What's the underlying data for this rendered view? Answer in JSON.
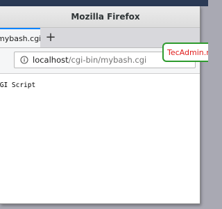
{
  "window": {
    "title": "Mozilla Firefox"
  },
  "tabs": [
    {
      "label": "mybash.cgi",
      "active": true
    }
  ],
  "new_tab_glyph": "+",
  "urlbar": {
    "host": "localhost",
    "path": "/cgi-bin/mybash.cgi",
    "icon": "info-icon"
  },
  "page": {
    "text": "CGI Script"
  },
  "watermark": {
    "text": "TecAdmin.net",
    "border_color": "#2e9b2e",
    "text_color": "#e01b1b"
  },
  "colors": {
    "tab_accent": "#0a84ff",
    "desktop": "#a9a9b3"
  }
}
